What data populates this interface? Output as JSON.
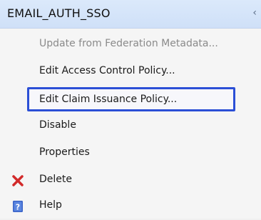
{
  "header": {
    "title": "EMAIL_AUTH_SSO",
    "edge_glyph": "‹"
  },
  "menu": {
    "items": [
      {
        "label": "Update from Federation Metadata...",
        "state": "disabled"
      },
      {
        "label": "Edit Access Control Policy..."
      },
      {
        "label": "Edit Claim Issuance Policy...",
        "state": "highlighted"
      },
      {
        "label": "Disable"
      },
      {
        "label": "Properties"
      },
      {
        "label": "Delete",
        "icon": "delete-x-icon"
      },
      {
        "label": "Help",
        "icon": "help-book-icon"
      }
    ]
  },
  "colors": {
    "header_bg": "#d7e6fa",
    "highlight_border": "#2b4fd6",
    "delete_icon": "#d22a2a",
    "help_icon": "#3a64c8",
    "disabled_text": "#8a8a8a"
  }
}
